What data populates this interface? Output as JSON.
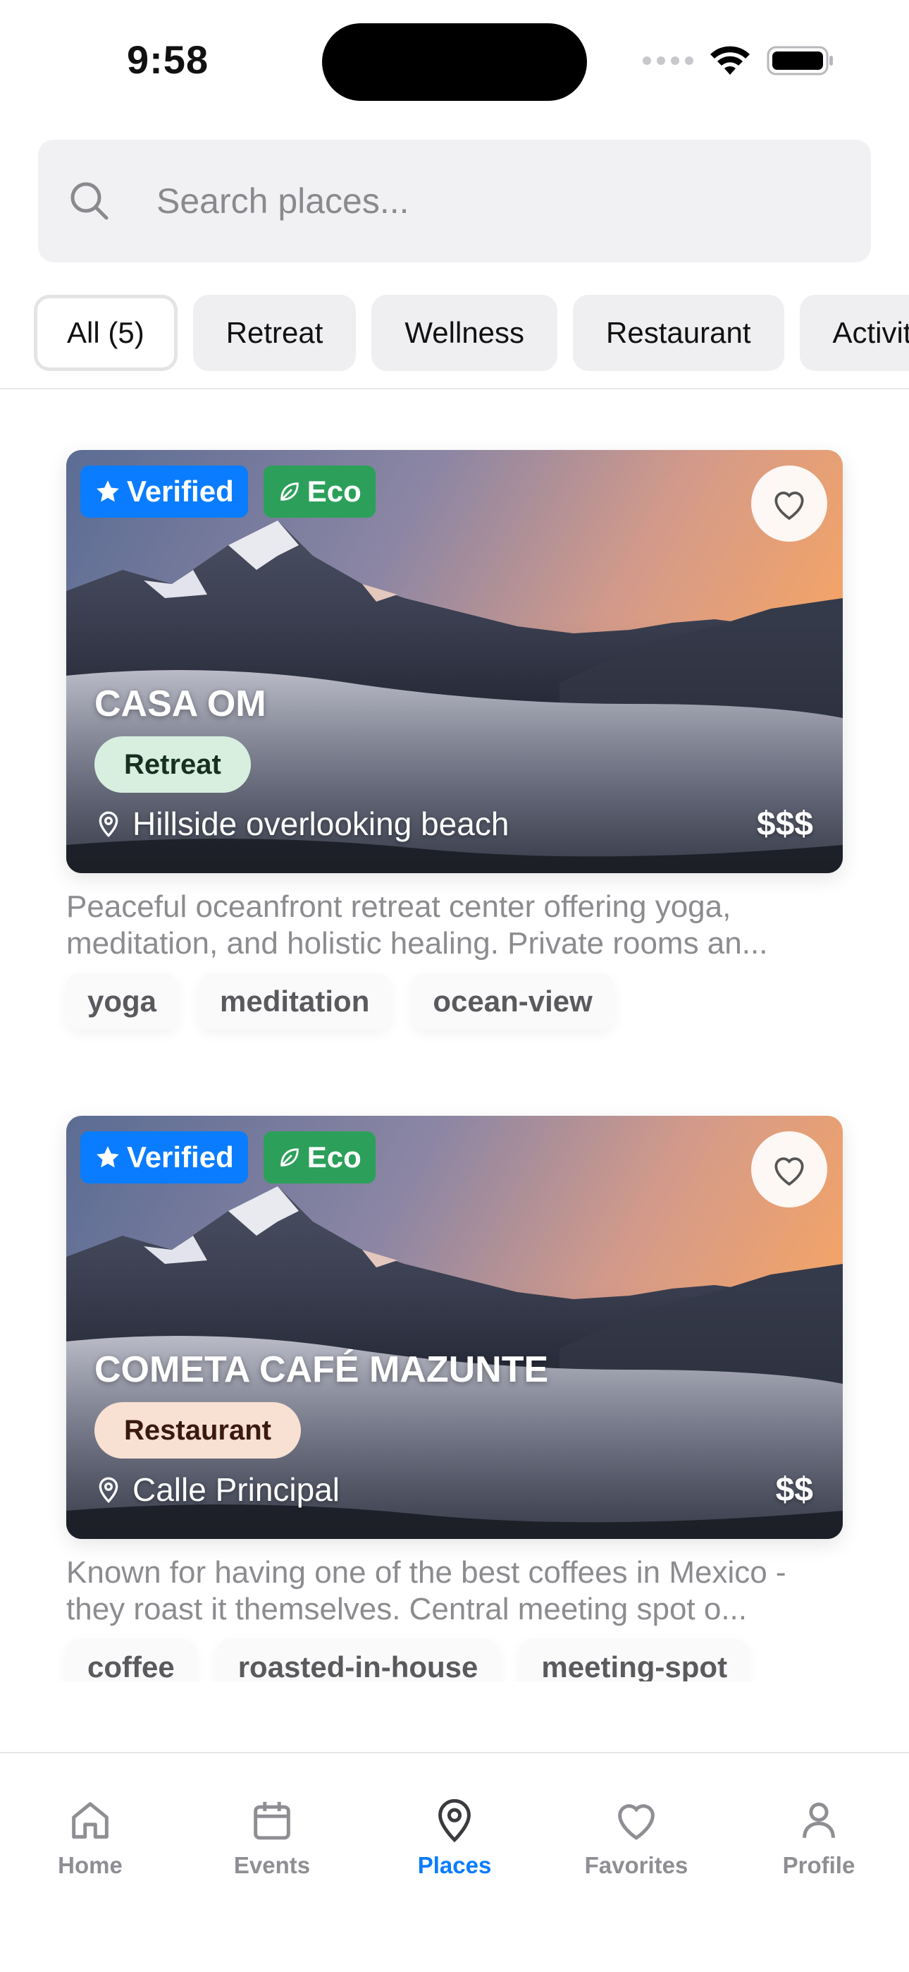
{
  "status_bar": {
    "time": "9:58"
  },
  "search": {
    "placeholder": "Search places..."
  },
  "filters": [
    {
      "label": "All (5)",
      "active": true
    },
    {
      "label": "Retreat",
      "active": false
    },
    {
      "label": "Wellness",
      "active": false
    },
    {
      "label": "Restaurant",
      "active": false
    },
    {
      "label": "Activity",
      "active": false
    }
  ],
  "places": [
    {
      "name": "CASA OM",
      "verified_label": "Verified",
      "eco_label": "Eco",
      "category": "Retreat",
      "location": "Hillside overlooking beach",
      "price": "$$$",
      "description": "Peaceful oceanfront retreat center offering yoga, meditation, and holistic healing. Private rooms an...",
      "tags": [
        "yoga",
        "meditation",
        "ocean-view"
      ]
    },
    {
      "name": "COMETA CAFÉ MAZUNTE",
      "verified_label": "Verified",
      "eco_label": "Eco",
      "category": "Restaurant",
      "location": "Calle Principal",
      "price": "$$",
      "description": "Known for having one of the best coffees in Mexico - they roast it themselves. Central meeting spot o...",
      "tags": [
        "coffee",
        "roasted-in-house",
        "meeting-spot"
      ]
    }
  ],
  "tab_bar": {
    "items": [
      {
        "label": "Home",
        "icon": "home-icon"
      },
      {
        "label": "Events",
        "icon": "calendar-icon"
      },
      {
        "label": "Places",
        "icon": "map-pin-icon"
      },
      {
        "label": "Favorites",
        "icon": "heart-icon"
      },
      {
        "label": "Profile",
        "icon": "person-icon"
      }
    ],
    "active": "Places"
  },
  "colors": {
    "accent": "#0a7cff",
    "verified_badge": "#0a7cff",
    "eco_badge": "#2ca05a",
    "retreat_pill": "#d8efdf",
    "restaurant_pill": "#f8e0d2",
    "muted_text": "#8e8e93"
  }
}
